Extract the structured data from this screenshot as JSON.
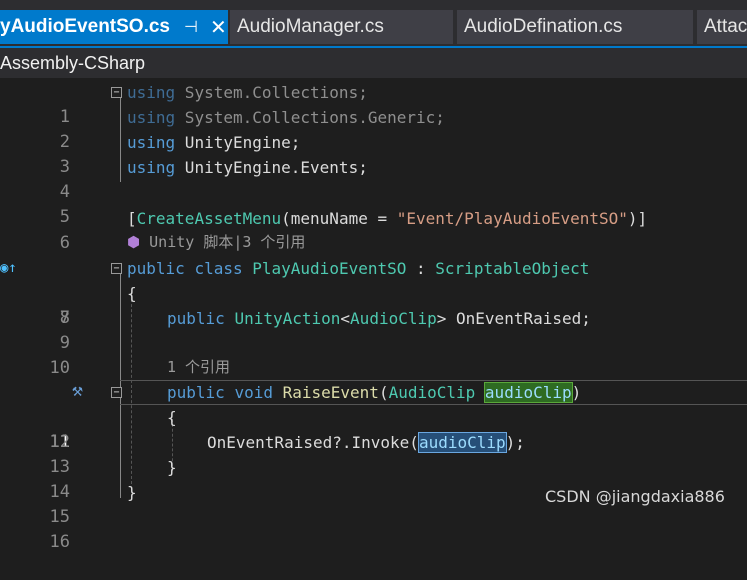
{
  "tabs": [
    {
      "label": "yAudioEventSO.cs",
      "active": true,
      "pin_icon": "⊣",
      "close_icon": "✕"
    },
    {
      "label": "AudioManager.cs",
      "active": false
    },
    {
      "label": "AudioDefination.cs",
      "active": false
    },
    {
      "label": "Attac",
      "active": false
    }
  ],
  "project": {
    "name": "Assembly-CSharp"
  },
  "editor": {
    "line_numbers": [
      "1",
      "2",
      "3",
      "4",
      "5",
      "6",
      "7",
      "8",
      "9",
      "10",
      "11",
      "12",
      "13",
      "14",
      "15",
      "16"
    ],
    "lines": {
      "l1": {
        "kw": "using",
        "rest": " System.Collections;"
      },
      "l2": {
        "kw": "using",
        "rest": " System.Collections.Generic;"
      },
      "l3": {
        "kw": "using",
        "rest": " UnityEngine;"
      },
      "l4": {
        "kw": "using",
        "rest": " UnityEngine.Events;"
      },
      "l6": {
        "open": "[",
        "attr": "CreateAssetMenu",
        "args_open": "(menuName = ",
        "str": "\"Event/PlayAudioEventSO\"",
        "close": ")]"
      },
      "hint_unity": "Unity 脚本|3 个引用",
      "l7": {
        "kw1": "public",
        "kw2": "class",
        "name": "PlayAudioEventSO",
        "sep": " : ",
        "base": "ScriptableObject"
      },
      "l8": {
        "text": "{"
      },
      "l9": {
        "kw": "public",
        "type": "UnityAction",
        "generic_open": "<",
        "generic_arg": "AudioClip",
        "generic_close": ">",
        "rest": " OnEventRaised;"
      },
      "hint_refs": "1 个引用",
      "l11": {
        "kw1": "public",
        "kw2": "void",
        "name": "RaiseEvent",
        "paren_open": "(",
        "type": "AudioClip",
        "param": "audioClip",
        "paren_close": ")"
      },
      "l12": {
        "text": "{"
      },
      "l13": {
        "call": "OnEventRaised?.Invoke",
        "paren_open": "(",
        "arg": "audioClip",
        "paren_close": ");"
      },
      "l14": {
        "text": "}"
      },
      "l15": {
        "text": "}"
      }
    },
    "current_line": "11"
  },
  "gutter_icons": {
    "line7": "implements-icon",
    "line11": "screwdriver-icon"
  },
  "watermark": "CSDN @jiangdaxia886",
  "colors": {
    "accent": "#007acc",
    "keyword": "#569cd6",
    "type": "#4ec9b0",
    "string": "#d69d85"
  }
}
